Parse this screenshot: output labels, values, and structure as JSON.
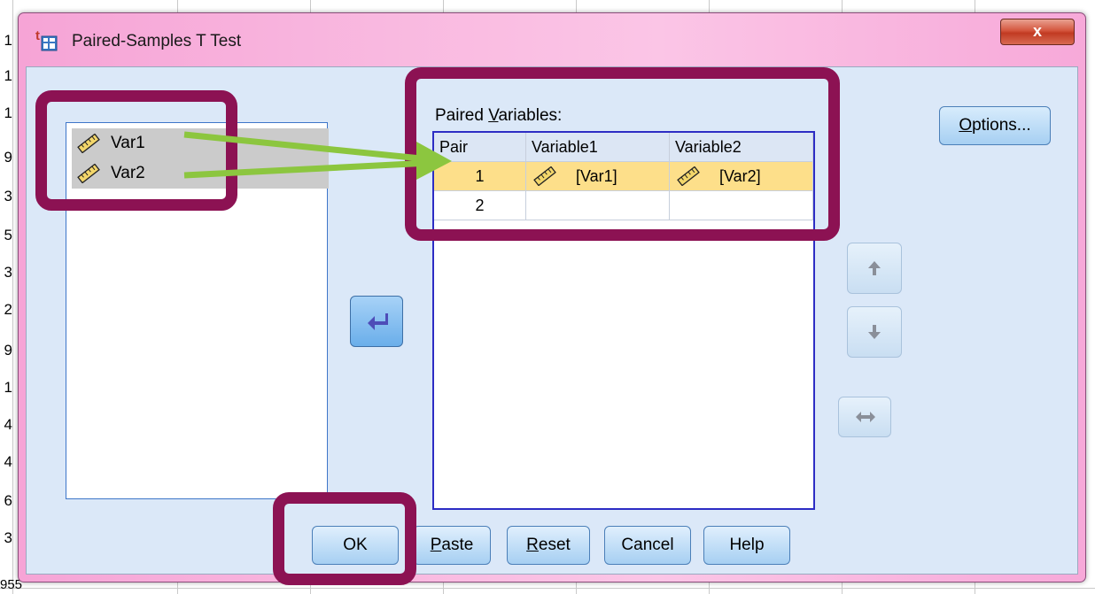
{
  "window": {
    "title": "Paired-Samples T Test",
    "close_label": "x"
  },
  "source_list": {
    "items": [
      {
        "label": "Var1",
        "icon": "scale-ruler-icon"
      },
      {
        "label": "Var2",
        "icon": "scale-ruler-icon"
      }
    ]
  },
  "paired": {
    "label_prefix": "Paired ",
    "label_accel": "V",
    "label_suffix": "ariables:",
    "columns": [
      "Pair",
      "Variable1",
      "Variable2"
    ],
    "rows": [
      {
        "pair": "1",
        "var1": "[Var1]",
        "var2": "[Var2]",
        "selected": true
      },
      {
        "pair": "2",
        "var1": "",
        "var2": "",
        "selected": false
      }
    ]
  },
  "buttons": {
    "options_accel": "O",
    "options_rest": "ptions...",
    "ok": "OK",
    "paste_accel": "P",
    "paste_rest": "aste",
    "reset_accel": "R",
    "reset_rest": "eset",
    "cancel": "Cancel",
    "help": "Help"
  },
  "background_rows": [
    "1",
    "1",
    "1",
    "9",
    "3",
    "5",
    "3",
    "2",
    "9",
    "1",
    "4",
    "4",
    "6",
    "3",
    "955"
  ],
  "colors": {
    "highlight": "#8c1253",
    "arrow": "#8cc63f",
    "selected_row": "#fddf8a"
  }
}
